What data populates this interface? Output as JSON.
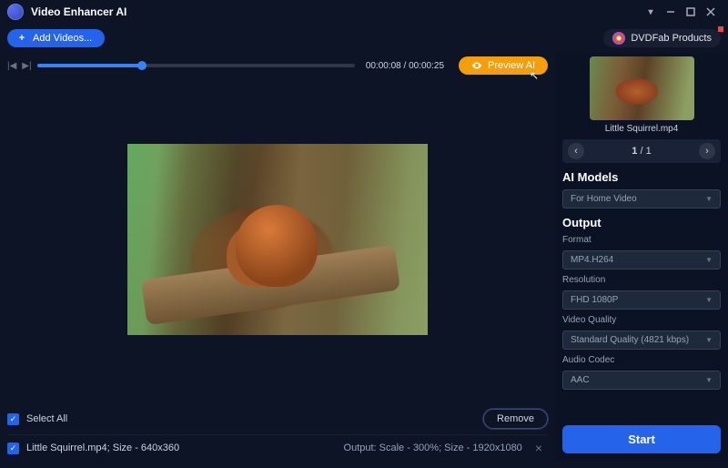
{
  "app": {
    "title": "Video Enhancer AI"
  },
  "topbar": {
    "add_videos": "Add Videos...",
    "dvdfab": "DVDFab Products"
  },
  "player": {
    "time_current": "00:00:08",
    "time_total": "00:00:25",
    "progress_pct": 33,
    "preview_label": "Preview AI"
  },
  "list": {
    "select_all": "Select All",
    "remove": "Remove",
    "rows": [
      {
        "file": "Little Squirrel.mp4; Size - 640x360",
        "output": "Output: Scale - 300%; Size - 1920x1080"
      }
    ]
  },
  "side": {
    "thumb_name": "Little Squirrel.mp4",
    "pager_cur": "1",
    "pager_sep": " / ",
    "pager_total": "1",
    "ai_models_h": "AI Models",
    "ai_model": "For Home Video",
    "output_h": "Output",
    "format_l": "Format",
    "format_v": "MP4.H264",
    "res_l": "Resolution",
    "res_v": "FHD 1080P",
    "vq_l": "Video Quality",
    "vq_v": "Standard Quality (4821 kbps)",
    "ac_l": "Audio Codec",
    "ac_v": "AAC",
    "start": "Start"
  }
}
